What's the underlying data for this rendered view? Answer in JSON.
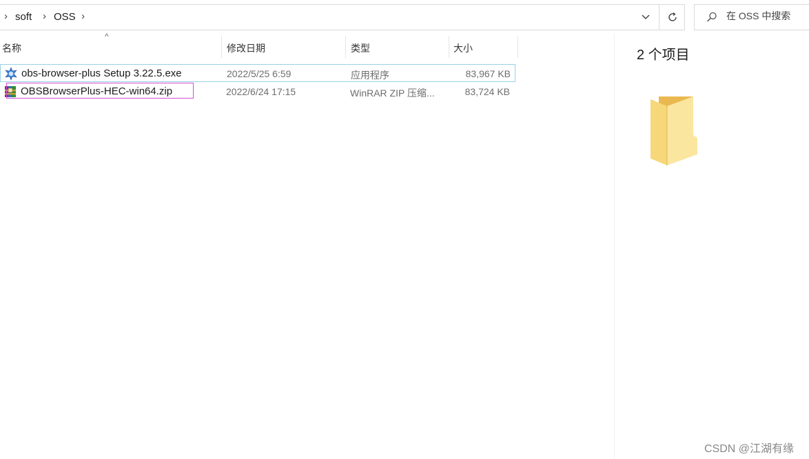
{
  "breadcrumb": {
    "items": [
      "soft",
      "OSS"
    ]
  },
  "search": {
    "placeholder": "在 OSS 中搜索"
  },
  "columns": {
    "name": "名称",
    "date": "修改日期",
    "type": "类型",
    "size": "大小"
  },
  "files": [
    {
      "name": "obs-browser-plus Setup 3.22.5.exe",
      "date": "2022/5/25 6:59",
      "type": "应用程序",
      "size": "83,967 KB",
      "icon": "installer-icon"
    },
    {
      "name": "OBSBrowserPlus-HEC-win64.zip",
      "date": "2022/6/24 17:15",
      "type": "WinRAR ZIP 压缩...",
      "size": "83,724 KB",
      "icon": "winrar-archive-icon"
    }
  ],
  "preview": {
    "item_count": "2 个项目",
    "icon": "folder-icon"
  },
  "watermark": "CSDN @江湖有缘",
  "colors": {
    "hover_border": "#99d1e6",
    "selection_outline": "#d04fd8",
    "folder": "#f6d77a"
  }
}
